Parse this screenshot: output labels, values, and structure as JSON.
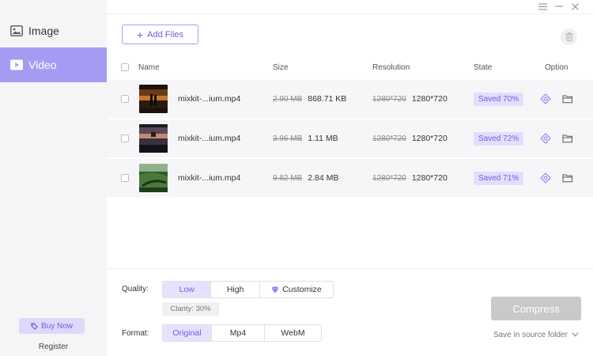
{
  "sidebar": {
    "items": [
      {
        "label": "Image",
        "icon": "image-icon"
      },
      {
        "label": "Video",
        "icon": "video-icon",
        "selected": true
      }
    ],
    "buy_now": "Buy Now",
    "register": "Register"
  },
  "toolbar": {
    "add_files": "Add Files"
  },
  "table": {
    "columns": [
      "Name",
      "Size",
      "Resolution",
      "State",
      "Option"
    ],
    "rows": [
      {
        "name": "mixkit-...ium.mp4",
        "size_old": "2.90 MB",
        "size_new": "868.71 KB",
        "res_old": "1280*720",
        "res_new": "1280*720",
        "state": "Saved 70%"
      },
      {
        "name": "mixkit-...ium.mp4",
        "size_old": "3.96 MB",
        "size_new": "1.11 MB",
        "res_old": "1280*720",
        "res_new": "1280*720",
        "state": "Saved 72%"
      },
      {
        "name": "mixkit-...ium.mp4",
        "size_old": "9.82 MB",
        "size_new": "2.84 MB",
        "res_old": "1280*720",
        "res_new": "1280*720",
        "state": "Saved 71%"
      }
    ]
  },
  "settings": {
    "quality_label": "Quality:",
    "quality_options": [
      "Low",
      "High",
      "Customize"
    ],
    "quality_selected": "Low",
    "clarity": "Clarity: 30%",
    "format_label": "Format:",
    "format_options": [
      "Original",
      "Mp4",
      "WebM"
    ],
    "format_selected": "Original"
  },
  "actions": {
    "compress": "Compress",
    "save_location": "Save in source folder"
  },
  "colors": {
    "accent": "#a69bf3",
    "accent_dark": "#6d5fe0",
    "accent_light": "#e3defc",
    "disabled_button": "#c9c9cc"
  }
}
